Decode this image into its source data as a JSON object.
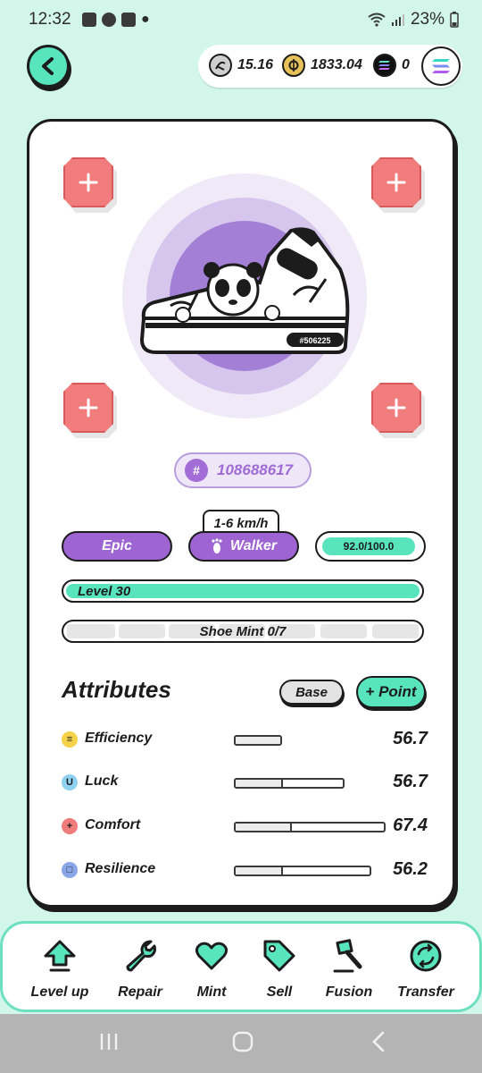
{
  "status_bar": {
    "time": "12:32",
    "battery": "23%",
    "notification_icons": [
      "gallery-icon",
      "messenger-icon",
      "youtube-icon",
      "dot-icon"
    ],
    "system_icons": [
      "wifi-icon",
      "signal-icon",
      "battery-icon"
    ]
  },
  "header": {
    "wallet": {
      "gst_value": "15.16",
      "gmt_value": "1833.04",
      "sol_value": "0"
    }
  },
  "sneaker": {
    "serial": "#506225",
    "id_prefix": "#",
    "id": "108688617",
    "speed_range": "1-6 km/h",
    "rarity": "Epic",
    "type": "Walker",
    "durability": "92.0/100.0",
    "durability_fraction": 0.92,
    "level_label": "Level 30",
    "shoe_mint_label": "Shoe Mint 0/7"
  },
  "attributes": {
    "title": "Attributes",
    "base_label": "Base",
    "point_label": "+ Point",
    "items": [
      {
        "name": "Efficiency",
        "value": "56.7",
        "icon_letter": "≡",
        "icon_color": "#f5d24a"
      },
      {
        "name": "Luck",
        "value": "56.7",
        "icon_letter": "U",
        "icon_color": "#8fd1f0"
      },
      {
        "name": "Comfort",
        "value": "67.4",
        "icon_letter": "+",
        "icon_color": "#f07c7c"
      },
      {
        "name": "Resilience",
        "value": "56.2",
        "icon_letter": "□",
        "icon_color": "#8aa6e8"
      }
    ]
  },
  "bottom_nav": {
    "items": [
      {
        "label": "Level up",
        "icon": "level-up-icon"
      },
      {
        "label": "Repair",
        "icon": "wrench-icon"
      },
      {
        "label": "Mint",
        "icon": "heart-icon"
      },
      {
        "label": "Sell",
        "icon": "tag-icon"
      },
      {
        "label": "Fusion",
        "icon": "hammer-icon"
      },
      {
        "label": "Transfer",
        "icon": "transfer-icon"
      }
    ]
  },
  "colors": {
    "accent": "#58e4bc",
    "background": "#d2f6ea",
    "epic_purple": "#9d64d2",
    "gem_slot": "#f07c7c"
  }
}
